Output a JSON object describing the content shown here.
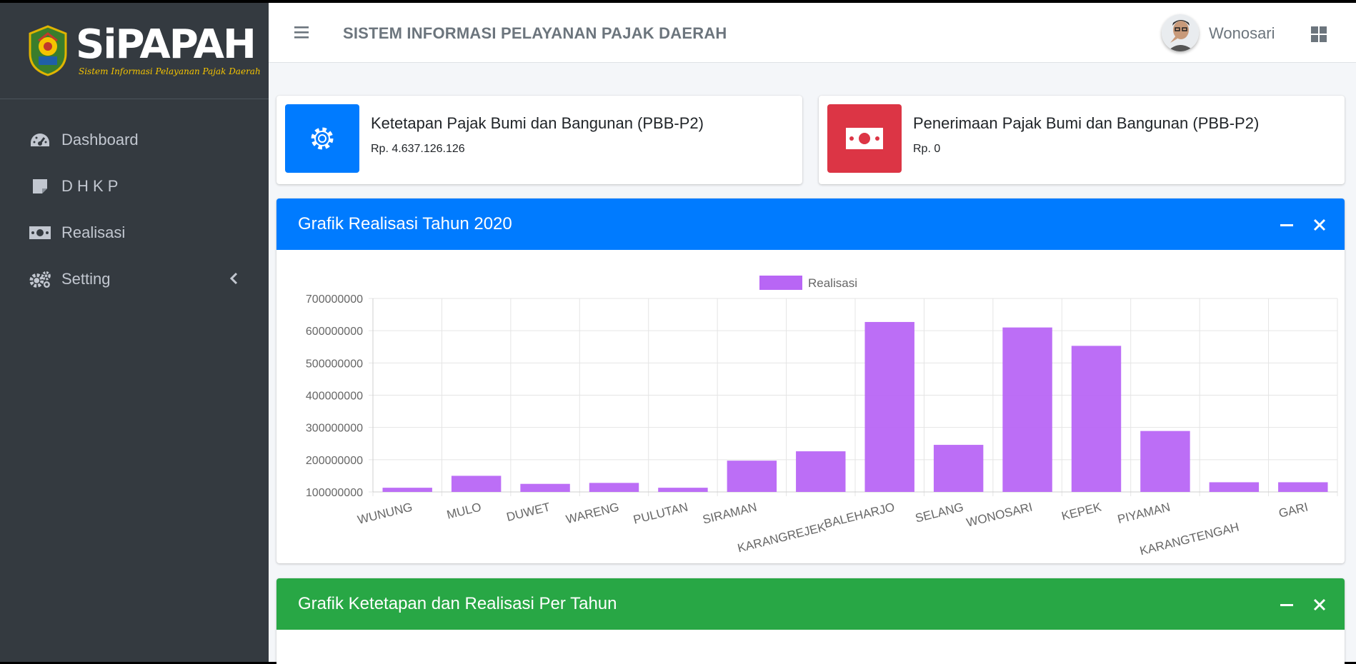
{
  "brand": {
    "name": "SiPAPAH",
    "subtitle": "Sistem Informasi Pelayanan Pajak Daerah"
  },
  "sidebar": {
    "items": [
      {
        "label": "Dashboard",
        "icon": "tachometer-icon"
      },
      {
        "label": "D H K P",
        "icon": "sticky-note-icon"
      },
      {
        "label": "Realisasi",
        "icon": "money-bill-icon"
      },
      {
        "label": "Setting",
        "icon": "cogs-icon"
      }
    ]
  },
  "navbar": {
    "title": "SISTEM INFORMASI PELAYANAN PAJAK DAERAH",
    "user_name": "Wonosari"
  },
  "info_boxes": [
    {
      "title": "Ketetapan Pajak Bumi dan Bangunan (PBB-P2)",
      "value": "Rp. 4.637.126.126",
      "color": "#007bff",
      "icon": "gear-icon"
    },
    {
      "title": "Penerimaan Pajak Bumi dan Bangunan (PBB-P2)",
      "value": "Rp. 0",
      "color": "#dc3545",
      "icon": "money-bill-icon"
    }
  ],
  "cards": [
    {
      "title": "Grafik Realisasi Tahun 2020",
      "color": "#007bff"
    },
    {
      "title": "Grafik Ketetapan dan Realisasi Per Tahun",
      "color": "#28a745"
    }
  ],
  "chart_data": {
    "type": "bar",
    "categories": [
      "WUNUNG",
      "MULO",
      "DUWET",
      "WARENG",
      "PULUTAN",
      "SIRAMAN",
      "KARANGREJEK",
      "BALEHARJO",
      "SELANG",
      "WONOSARI",
      "KEPEK",
      "PIYAMAN",
      "KARANGTENGAH",
      "GARI"
    ],
    "series": [
      {
        "name": "Realisasi",
        "color": "#b866f5",
        "values": [
          113000000,
          150000000,
          125000000,
          128000000,
          113000000,
          197000000,
          226000000,
          627000000,
          246000000,
          610000000,
          553000000,
          289000000,
          130000000,
          130000000
        ]
      }
    ],
    "yticks": [
      "700000000",
      "600000000",
      "500000000",
      "400000000",
      "300000000",
      "200000000",
      "100000000"
    ],
    "ylim": [
      100000000,
      700000000
    ],
    "grid": true,
    "legend": "top"
  }
}
